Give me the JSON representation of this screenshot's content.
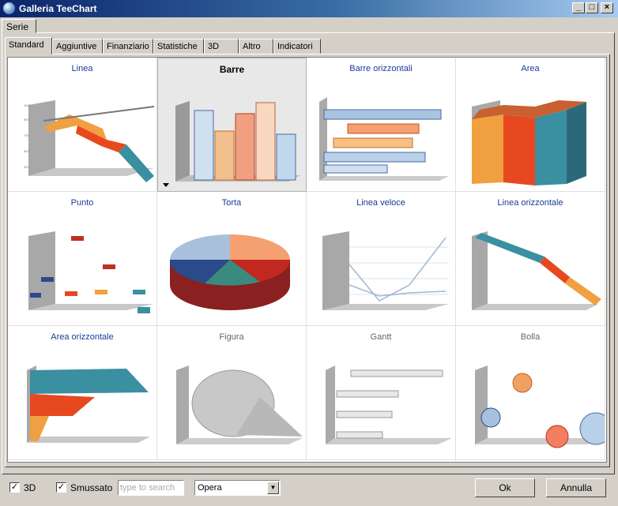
{
  "window": {
    "title": "Galleria TeeChart"
  },
  "outer_tab": {
    "label": "Serie"
  },
  "tabs": [
    {
      "label": "Standard",
      "active": true
    },
    {
      "label": "Aggiuntive"
    },
    {
      "label": "Finanziario"
    },
    {
      "label": "Statistiche"
    },
    {
      "label": "3D"
    },
    {
      "label": "Altro"
    },
    {
      "label": "Indicatori"
    }
  ],
  "gallery": [
    {
      "label": "Linea",
      "icon": "line-chart-icon"
    },
    {
      "label": "Barre",
      "icon": "bar-chart-icon",
      "selected": true
    },
    {
      "label": "Barre orizzontali",
      "icon": "horizontal-bar-chart-icon"
    },
    {
      "label": "Area",
      "icon": "area-chart-icon"
    },
    {
      "label": "Punto",
      "icon": "point-chart-icon"
    },
    {
      "label": "Torta",
      "icon": "pie-chart-icon"
    },
    {
      "label": "Linea veloce",
      "icon": "fast-line-chart-icon"
    },
    {
      "label": "Linea orizzontale",
      "icon": "horizontal-line-chart-icon"
    },
    {
      "label": "Area orizzontale",
      "icon": "horizontal-area-chart-icon"
    },
    {
      "label": "Figura",
      "icon": "shape-chart-icon",
      "disabled": true
    },
    {
      "label": "Gantt",
      "icon": "gantt-chart-icon",
      "disabled": true
    },
    {
      "label": "Bolla",
      "icon": "bubble-chart-icon",
      "disabled": true
    }
  ],
  "options": {
    "checkbox_3d": {
      "label": "3D",
      "checked": true
    },
    "checkbox_smooth": {
      "label": "Smussato",
      "checked": true
    },
    "search_placeholder": "type to search",
    "theme_selected": "Opera"
  },
  "buttons": {
    "ok": "Ok",
    "cancel": "Annulla"
  },
  "colors": {
    "orange": "#f0a040",
    "red": "#e84820",
    "teal": "#3a8fa0",
    "navy": "#1a3a9a"
  }
}
